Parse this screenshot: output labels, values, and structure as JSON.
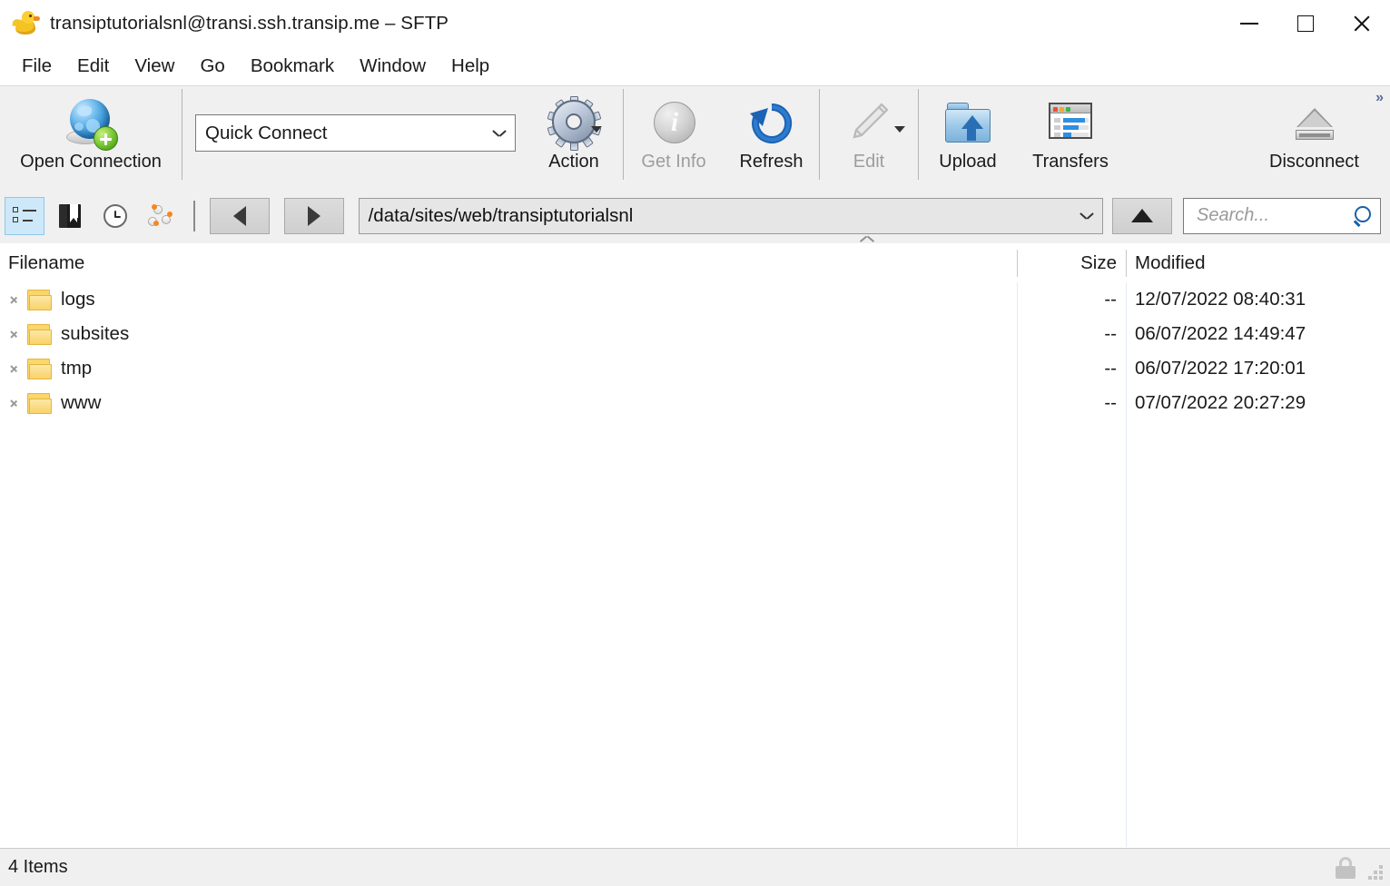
{
  "window": {
    "title": "transiptutorialsnl@transi.ssh.transip.me – SFTP",
    "app_icon": "duck-icon",
    "minimize_label": "Minimize",
    "maximize_label": "Maximize",
    "close_label": "Close"
  },
  "menubar": {
    "items": [
      {
        "label": "File"
      },
      {
        "label": "Edit"
      },
      {
        "label": "View"
      },
      {
        "label": "Go"
      },
      {
        "label": "Bookmark"
      },
      {
        "label": "Window"
      },
      {
        "label": "Help"
      }
    ]
  },
  "toolbar": {
    "open_connection": {
      "label": "Open Connection",
      "icon": "globe-plus-icon"
    },
    "quick_connect": {
      "value": "Quick Connect",
      "icon": "chevron-down-icon"
    },
    "action": {
      "label": "Action",
      "icon": "gear-icon",
      "menu_icon": "caret-down-icon"
    },
    "get_info": {
      "label": "Get Info",
      "icon": "info-circle-icon",
      "disabled": true
    },
    "refresh": {
      "label": "Refresh",
      "icon": "refresh-arrow-icon"
    },
    "edit": {
      "label": "Edit",
      "icon": "pencil-icon",
      "menu_icon": "caret-down-icon",
      "disabled": true
    },
    "upload": {
      "label": "Upload",
      "icon": "upload-folder-icon"
    },
    "transfers": {
      "label": "Transfers",
      "icon": "transfers-window-icon"
    },
    "disconnect": {
      "label": "Disconnect",
      "icon": "eject-icon"
    },
    "overflow": "»"
  },
  "navbar": {
    "view_browser": {
      "icon": "list-view-icon",
      "selected": true
    },
    "bookmarks": {
      "icon": "bookmark-book-icon"
    },
    "history": {
      "icon": "clock-icon"
    },
    "connections": {
      "icon": "network-nodes-icon"
    },
    "back": {
      "icon": "triangle-left-icon"
    },
    "forward": {
      "icon": "triangle-right-icon"
    },
    "path": {
      "value": "/data/sites/web/transiptutorialsnl",
      "dropdown_icon": "chevron-down-icon"
    },
    "up": {
      "icon": "triangle-up-icon"
    },
    "search": {
      "placeholder": "Search...",
      "value": "",
      "icon": "search-icon"
    }
  },
  "filelist": {
    "columns": {
      "filename": "Filename",
      "size": "Size",
      "modified": "Modified"
    },
    "rows": [
      {
        "name": "logs",
        "size": "--",
        "modified": "12/07/2022 08:40:31",
        "icon": "folder-icon",
        "expander": "chevron-right-icon"
      },
      {
        "name": "subsites",
        "size": "--",
        "modified": "06/07/2022 14:49:47",
        "icon": "folder-icon",
        "expander": "chevron-right-icon"
      },
      {
        "name": "tmp",
        "size": "--",
        "modified": "06/07/2022 17:20:01",
        "icon": "folder-icon",
        "expander": "chevron-right-icon"
      },
      {
        "name": "www",
        "size": "--",
        "modified": "07/07/2022 20:27:29",
        "icon": "folder-icon",
        "expander": "chevron-right-icon"
      }
    ]
  },
  "statusbar": {
    "items_text": "4 Items",
    "security_icon": "lock-icon",
    "resize_grip": "resize-grip-icon"
  },
  "colors": {
    "toolbar_bg": "#f0f0f0",
    "selection_blue": "#cde8f9",
    "folder_yellow": "#fbd66b",
    "accent_blue": "#2f8fe0"
  }
}
